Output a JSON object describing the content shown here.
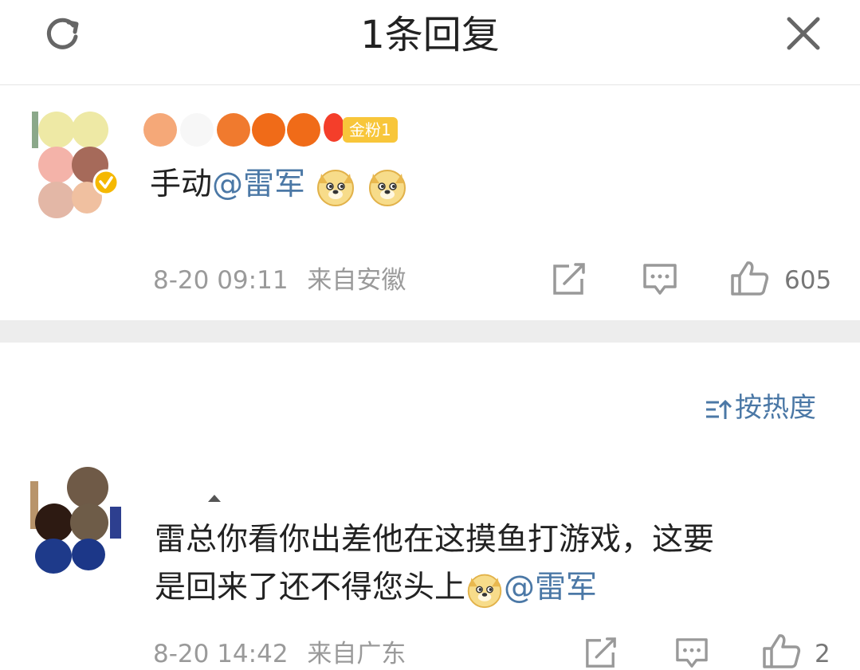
{
  "header": {
    "title": "1条回复",
    "refresh_icon": "refresh-icon",
    "close_icon": "close-icon"
  },
  "main_comment": {
    "badge": "金粉1",
    "text_prefix": "手动",
    "mention": "@雷军",
    "emoji": [
      "doge-emoji",
      "doge-emoji"
    ],
    "time": "8-20 09:11",
    "source": "来自安徽",
    "likes": "605"
  },
  "sort": {
    "label": "按热度"
  },
  "reply": {
    "text_line1": "雷总你看你出差他在这摸鱼打游戏，这要",
    "text_line2_prefix": "是回来了还不得您头上",
    "mention": "@雷军",
    "time": "8-20 14:42",
    "source": "来自广东",
    "likes": "2"
  },
  "colors": {
    "mention": "#4b78a6",
    "badge": "#f8c63a",
    "meta": "#9a9a9a",
    "divider": "#ededed"
  }
}
